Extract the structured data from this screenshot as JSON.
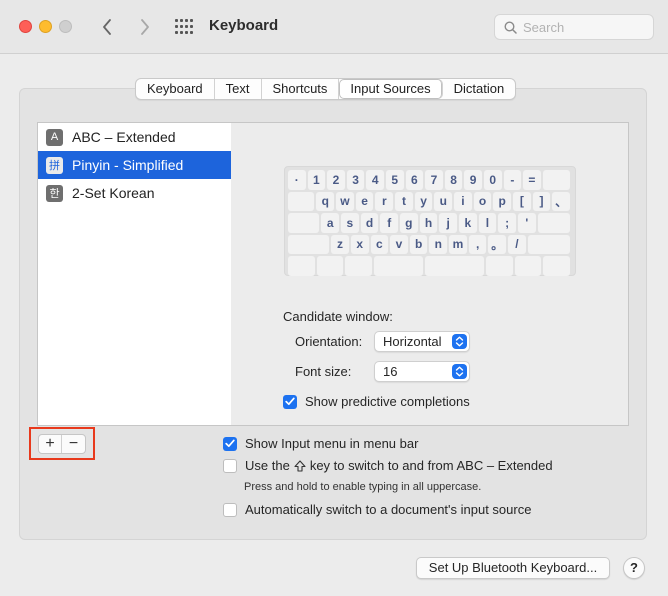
{
  "window": {
    "title": "Keyboard",
    "search_placeholder": "Search"
  },
  "tabs": [
    {
      "label": "Keyboard",
      "active": false
    },
    {
      "label": "Text",
      "active": false
    },
    {
      "label": "Shortcuts",
      "active": false
    },
    {
      "label": "Input Sources",
      "active": true
    },
    {
      "label": "Dictation",
      "active": false
    }
  ],
  "input_sources": [
    {
      "label": "ABC – Extended",
      "icon_glyph": "A",
      "icon": "abc-icon",
      "selected": false
    },
    {
      "label": "Pinyin - Simplified",
      "icon_glyph": "拼",
      "icon": "pinyin-icon",
      "selected": true
    },
    {
      "label": "2-Set Korean",
      "icon_glyph": "한",
      "icon": "korean-icon",
      "selected": false
    }
  ],
  "keyboard_rows": [
    [
      "·",
      "1",
      "2",
      "3",
      "4",
      "5",
      "6",
      "7",
      "8",
      "9",
      "0",
      "-",
      "="
    ],
    [
      "q",
      "w",
      "e",
      "r",
      "t",
      "y",
      "u",
      "i",
      "o",
      "p",
      "[",
      "]",
      "、"
    ],
    [
      "a",
      "s",
      "d",
      "f",
      "g",
      "h",
      "j",
      "k",
      "l",
      ";",
      "'"
    ],
    [
      "z",
      "x",
      "c",
      "v",
      "b",
      "n",
      "m",
      ",",
      "。",
      "/"
    ]
  ],
  "candidate": {
    "heading": "Candidate window:",
    "orientation_label": "Orientation:",
    "orientation_value": "Horizontal",
    "font_size_label": "Font size:",
    "font_size_value": "16",
    "predictive_label": "Show predictive completions",
    "predictive_checked": true
  },
  "options": {
    "show_menu_label": "Show Input menu in menu bar",
    "show_menu_checked": true,
    "shift_label_before": "Use the",
    "shift_label_after": "key to switch to and from ABC – Extended",
    "shift_checked": false,
    "shift_note": "Press and hold to enable typing in all uppercase.",
    "auto_switch_label": "Automatically switch to a document's input source",
    "auto_switch_checked": false
  },
  "buttons": {
    "add": "+",
    "remove": "−",
    "bluetooth": "Set Up Bluetooth Keyboard...",
    "help": "?"
  },
  "colors": {
    "accent": "#1d64dc",
    "checkbox": "#1d72f0",
    "highlight": "#e8391c",
    "key_text": "#4a5a86"
  }
}
